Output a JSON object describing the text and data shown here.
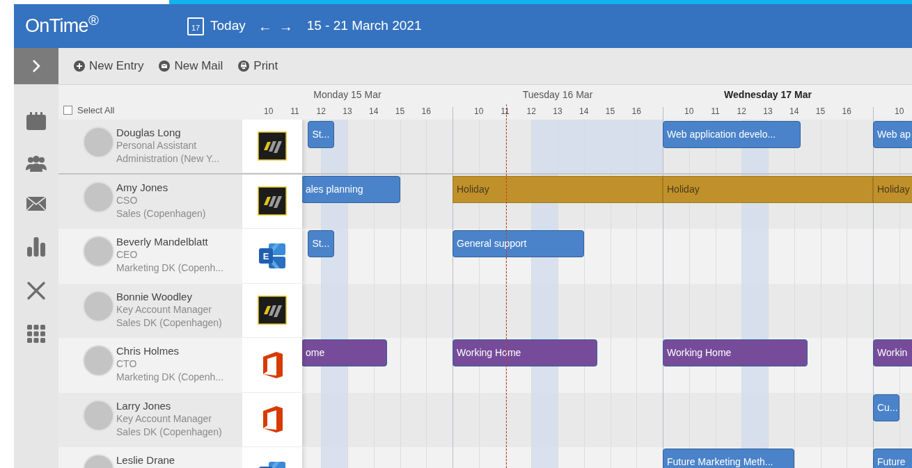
{
  "header": {
    "logo": "OnTime$^{®}$",
    "today_icon_day": "17",
    "today": "Today",
    "prev": "←",
    "next": "→",
    "range": "15 - 21 March 2021"
  },
  "toolbar": [
    {
      "kind": "new-entry",
      "label": "New Entry"
    },
    {
      "kind": "new-mail",
      "label": "New Mail"
    },
    {
      "kind": "print",
      "label": "Print"
    }
  ],
  "select_all": {
    "label": "Select All",
    "checked": false
  },
  "timeline": {
    "days": [
      {
        "label": "Monday 15 Mar",
        "selected": false,
        "hours": [
          "10",
          "11",
          "12",
          "13",
          "14",
          "15",
          "16"
        ]
      },
      {
        "label": "Tuesday 16 Mar",
        "selected": false,
        "hours": [
          "10",
          "11",
          "12",
          "13",
          "14",
          "15",
          "16"
        ]
      },
      {
        "label": "Wednesday 17 Mar",
        "selected": true,
        "hours": [
          "10",
          "11",
          "12",
          "13",
          "14",
          "15",
          "16"
        ]
      },
      {
        "hours": [
          "10"
        ]
      }
    ]
  },
  "rows": [
    {
      "name": "Douglas Long",
      "title": "Personal Assistant",
      "department": "Administration (New Y...",
      "kind": "slanted",
      "events": [
        {
          "text": "St...",
          "kind": "appointment",
          "color": "#4a83c9"
        },
        {
          "text": "Web application develo...",
          "kind": "appointment",
          "color": "#4a83c9"
        },
        {
          "text": "Web ap",
          "kind": "appointment",
          "color": "#4a83c9"
        }
      ]
    },
    {
      "name": "Amy Jones",
      "title": "CSO",
      "department": "Sales (Copenhagen)",
      "kind": "slanted",
      "events": [
        {
          "text": "ales planning",
          "kind": "appointment",
          "color": "#4a83c9"
        },
        {
          "text": "Holiday",
          "kind": "absence",
          "color": "#c0912b"
        },
        {
          "text": "Holiday",
          "kind": "absence",
          "color": "#c0912b"
        },
        {
          "text": "Holiday",
          "kind": "absence",
          "color": "#c0912b"
        }
      ]
    },
    {
      "name": "Beverly Mandelblatt",
      "title": "CEO",
      "department": "Marketing DK (Copenh...",
      "kind": "exchange",
      "calendar_badge": "E",
      "events": [
        {
          "text": "St...",
          "kind": "appointment",
          "color": "#4a83c9"
        },
        {
          "text": "General support",
          "kind": "appointment",
          "color": "#4a83c9"
        }
      ]
    },
    {
      "name": "Bonnie Woodley",
      "title": "Key Account Manager",
      "department": "Sales DK (Copenhagen)",
      "kind": "slanted"
    },
    {
      "name": "Chris Holmes",
      "title": "CTO",
      "department": "Marketing DK (Copenh...",
      "kind": "office",
      "events": [
        {
          "text": "ome",
          "kind": "appointment",
          "color": "#764c9a"
        },
        {
          "text": "Working Home",
          "kind": "appointment",
          "color": "#764c9a"
        },
        {
          "text": "Working Home",
          "kind": "appointment",
          "color": "#764c9a"
        },
        {
          "text": "Workin",
          "kind": "appointment",
          "color": "#764c9a"
        }
      ]
    },
    {
      "name": "Larry Jones",
      "title": "Key Account Manager",
      "department": "Sales DK (Copenhagen)",
      "kind": "office",
      "events": [
        {
          "text": "Cu...",
          "kind": "appointment",
          "color": "#4a83c9"
        }
      ]
    },
    {
      "name": "Leslie Drane",
      "kind": "exchange",
      "events": [
        {
          "text": "Future Marketing Meth...",
          "kind": "appointment",
          "color": "#4a83c9"
        },
        {
          "text": "Future",
          "kind": "appointment",
          "color": "#4a83c9"
        }
      ]
    }
  ]
}
